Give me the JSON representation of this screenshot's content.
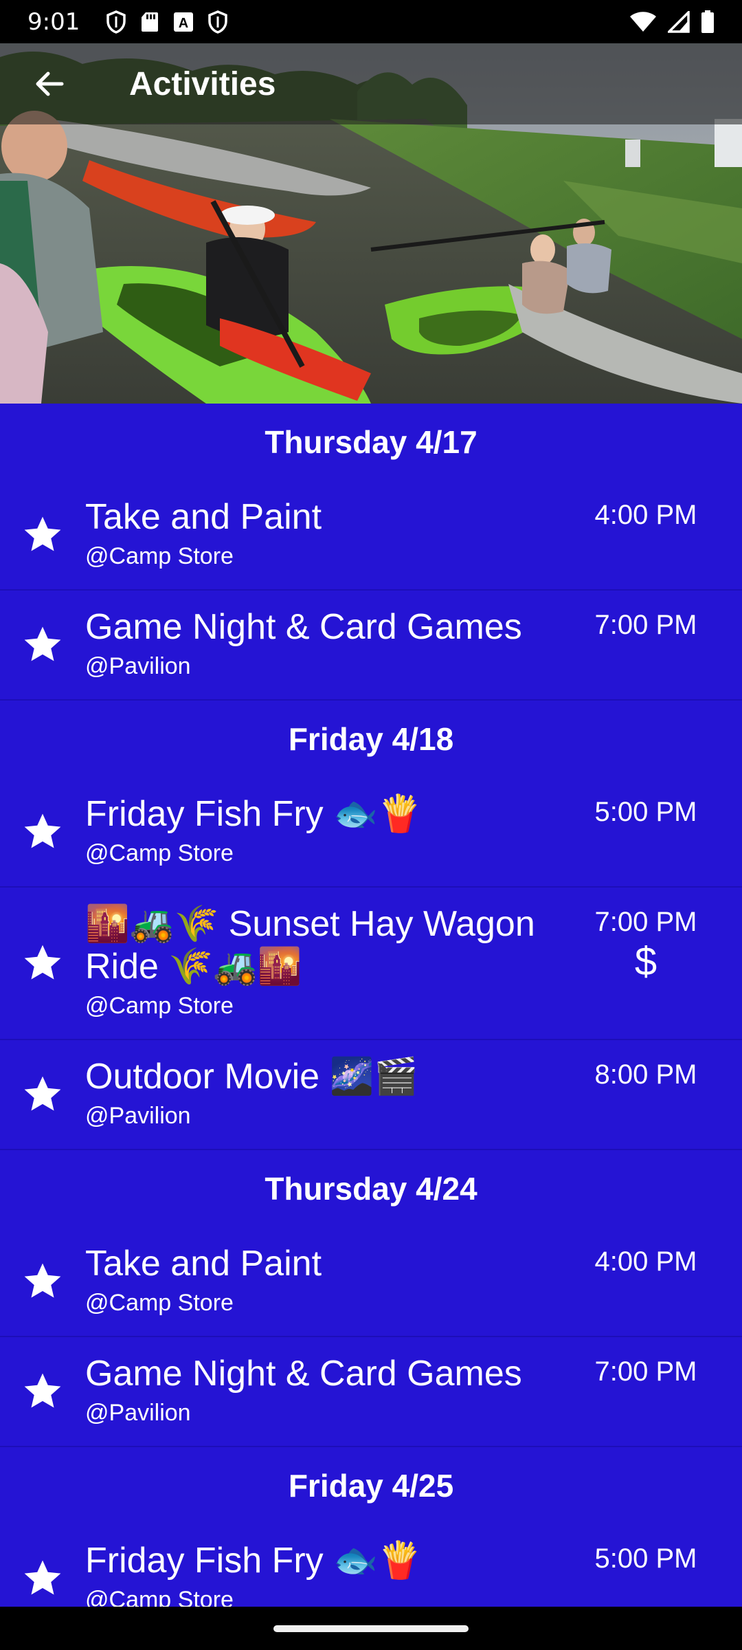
{
  "status_bar": {
    "time": "9:01",
    "left_icons": [
      "shield-icon",
      "sd-card-icon",
      "a-badge-icon",
      "shield-icon"
    ],
    "right_icons": [
      "wifi-icon",
      "cellular-signal-icon",
      "battery-icon"
    ]
  },
  "app_bar": {
    "title": "Activities",
    "back_icon": "arrow-back-icon"
  },
  "colors": {
    "list_background": "#2514d4",
    "divider": "#1d0fb8",
    "text": "#ffffff"
  },
  "schedule": [
    {
      "day": "Thursday 4/17",
      "events": [
        {
          "title": "Take and Paint",
          "location": "@Camp Store",
          "time": "4:00 PM",
          "price": ""
        },
        {
          "title": "Game Night & Card Games",
          "location": "@Pavilion",
          "time": "7:00 PM",
          "price": ""
        }
      ]
    },
    {
      "day": "Friday 4/18",
      "events": [
        {
          "title": "Friday Fish Fry 🐟🍟",
          "location": "@Camp Store",
          "time": "5:00 PM",
          "price": ""
        },
        {
          "title": "🌇🚜🌾 Sunset Hay Wagon Ride 🌾🚜🌇",
          "location": "@Camp Store",
          "time": "7:00 PM",
          "price": "$"
        },
        {
          "title": "Outdoor Movie 🌌🎬",
          "location": "@Pavilion",
          "time": "8:00 PM",
          "price": ""
        }
      ]
    },
    {
      "day": "Thursday 4/24",
      "events": [
        {
          "title": "Take and Paint",
          "location": "@Camp Store",
          "time": "4:00 PM",
          "price": ""
        },
        {
          "title": "Game Night & Card Games",
          "location": "@Pavilion",
          "time": "7:00 PM",
          "price": ""
        }
      ]
    },
    {
      "day": "Friday 4/25",
      "events": [
        {
          "title": "Friday Fish Fry 🐟🍟",
          "location": "@Camp Store",
          "time": "5:00 PM",
          "price": ""
        }
      ]
    }
  ]
}
